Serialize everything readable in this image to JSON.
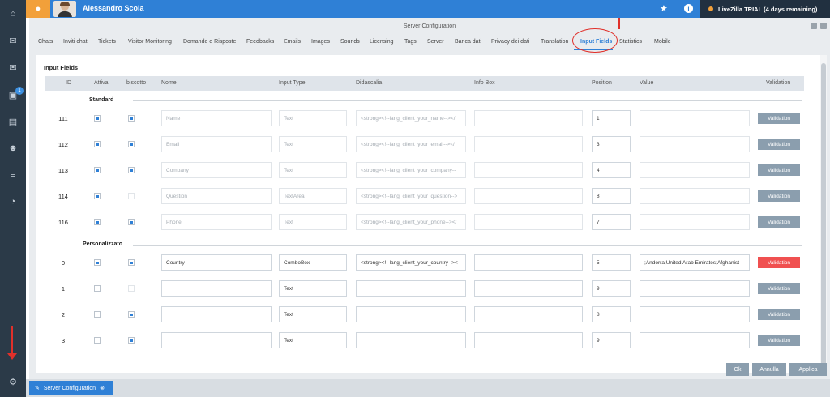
{
  "user": {
    "name": "Alessandro Scola"
  },
  "trial": "LiveZilla TRIAL (4 days remaining)",
  "panel_title": "Server Configuration",
  "tabs": [
    "Chats",
    "Inviti chat",
    "Tickets",
    "Visitor Monitoring",
    "Domande e Risposte",
    "Feedbacks",
    "Emails",
    "Images",
    "Sounds",
    "Licensing",
    "Tags",
    "Server",
    "Banca dati",
    "Privacy dei dati",
    "Translation",
    "Input Fields",
    "Statistics",
    "Mobile"
  ],
  "active_tab": "Input Fields",
  "section_title": "Input Fields",
  "columns": {
    "id": "ID",
    "attiva": "Attiva",
    "biscotto": "biscotto",
    "nome": "Nome",
    "input_type": "Input Type",
    "didascalia": "Didascalia",
    "info_box": "Info Box",
    "position": "Position",
    "value": "Value",
    "validation": "Validation"
  },
  "groups": {
    "standard": "Standard",
    "custom": "Personalizzato"
  },
  "standard_rows": [
    {
      "id": "111",
      "attiva": true,
      "biscotto": true,
      "nome": "Name",
      "type": "Text",
      "caption": "<strong><!--lang_client_your_name--></",
      "info": "",
      "position": "1",
      "value": "",
      "validation": "Validation"
    },
    {
      "id": "112",
      "attiva": true,
      "biscotto": true,
      "nome": "Email",
      "type": "Text",
      "caption": "<strong><!--lang_client_your_email--></",
      "info": "",
      "position": "3",
      "value": "",
      "validation": "Validation"
    },
    {
      "id": "113",
      "attiva": true,
      "biscotto": true,
      "nome": "Company",
      "type": "Text",
      "caption": "<strong><!--lang_client_your_company--",
      "info": "",
      "position": "4",
      "value": "",
      "validation": "Validation"
    },
    {
      "id": "114",
      "attiva": true,
      "biscotto": false,
      "nome": "Question",
      "type": "TextArea",
      "caption": "<strong><!--lang_client_your_question-->",
      "info": "",
      "position": "8",
      "value": "",
      "validation": "Validation"
    },
    {
      "id": "116",
      "attiva": true,
      "biscotto": true,
      "nome": "Phone",
      "type": "Text",
      "caption": "<strong><!--lang_client_your_phone--></",
      "info": "",
      "position": "7",
      "value": "",
      "validation": "Validation"
    }
  ],
  "custom_rows": [
    {
      "id": "0",
      "attiva": true,
      "biscotto": true,
      "nome": "Country",
      "type": "ComboBox",
      "caption": "<strong><!--lang_client_your_country--><",
      "info": "",
      "position": "5",
      "value": ";Andorra;United Arab Emirates;Afghanist",
      "validation": "Validation",
      "error": true
    },
    {
      "id": "1",
      "attiva": false,
      "biscotto": false,
      "nome": "",
      "type": "Text",
      "caption": "",
      "info": "",
      "position": "9",
      "value": "",
      "validation": "Validation"
    },
    {
      "id": "2",
      "attiva": false,
      "biscotto": true,
      "nome": "",
      "type": "Text",
      "caption": "",
      "info": "",
      "position": "8",
      "value": "",
      "validation": "Validation"
    },
    {
      "id": "3",
      "attiva": false,
      "biscotto": true,
      "nome": "",
      "type": "Text",
      "caption": "",
      "info": "",
      "position": "9",
      "value": "",
      "validation": "Validation"
    }
  ],
  "buttons": {
    "ok": "Ok",
    "annulla": "Annulla",
    "applica": "Applica"
  },
  "taskbar": {
    "item": "Server Configuration"
  },
  "sidebar_badge": "1",
  "colors": {
    "accent": "#2f80d6",
    "sidebar": "#2b3a48",
    "error": "#f05050"
  }
}
